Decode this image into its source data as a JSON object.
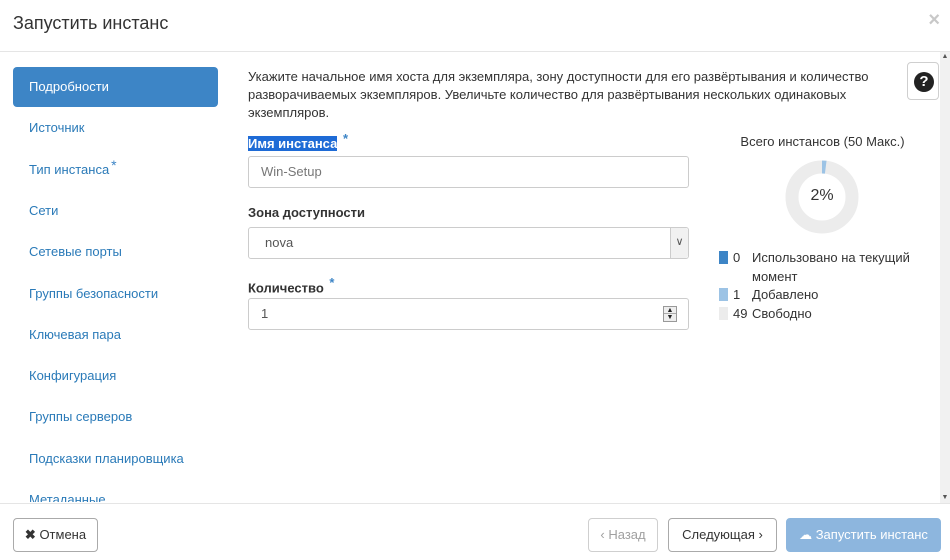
{
  "header": {
    "title": "Запустить инстанс",
    "close_glyph": "×"
  },
  "sidebar": {
    "items": [
      {
        "label": "Подробности",
        "active": true,
        "required": false
      },
      {
        "label": "Источник",
        "active": false,
        "required": false
      },
      {
        "label": "Тип инстанса",
        "active": false,
        "required": true
      },
      {
        "label": "Сети",
        "active": false,
        "required": false
      },
      {
        "label": "Сетевые порты",
        "active": false,
        "required": false
      },
      {
        "label": "Группы безопасности",
        "active": false,
        "required": false
      },
      {
        "label": "Ключевая пара",
        "active": false,
        "required": false
      },
      {
        "label": "Конфигурация",
        "active": false,
        "required": false
      },
      {
        "label": "Группы серверов",
        "active": false,
        "required": false
      },
      {
        "label": "Подсказки планировщика",
        "active": false,
        "required": false
      },
      {
        "label": "Метаданные",
        "active": false,
        "required": false
      }
    ]
  },
  "help_button": {
    "glyph": "?",
    "icon": "question-circle-icon"
  },
  "form": {
    "intro": "Укажите начальное имя хоста для экземпляра, зону доступности для его развёртывания и количество разворачиваемых экземпляров. Увеличьте количество для развёртывания нескольких одинаковых экземпляров.",
    "required_mark": "*",
    "instance_name": {
      "label": "Имя инстанса",
      "placeholder": "Win-Setup",
      "value": ""
    },
    "availability_zone": {
      "label": "Зона доступности",
      "value": "nova"
    },
    "count": {
      "label": "Количество",
      "value": "1"
    }
  },
  "quota": {
    "title": "Всего инстансов (50 Макс.)",
    "percent_label": "2%",
    "used_fraction": 0.02,
    "legend": [
      {
        "value": "0",
        "label": "Использовано на текущий момент",
        "color": "#3d85c6"
      },
      {
        "value": "1",
        "label": "Добавлено",
        "color": "#9cc3e5"
      },
      {
        "value": "49",
        "label": "Свободно",
        "color": "#ececec"
      }
    ],
    "colors": {
      "used": "#9cc3e5",
      "free": "#ececec"
    }
  },
  "footer": {
    "cancel": {
      "label": "Отмена",
      "icon": "x-icon"
    },
    "back": {
      "label": "Назад",
      "icon": "chevron-left-icon"
    },
    "next": {
      "label": "Следующая",
      "icon": "chevron-right-icon"
    },
    "launch": {
      "label": "Запустить инстанс",
      "icon": "cloud-upload-icon"
    }
  }
}
